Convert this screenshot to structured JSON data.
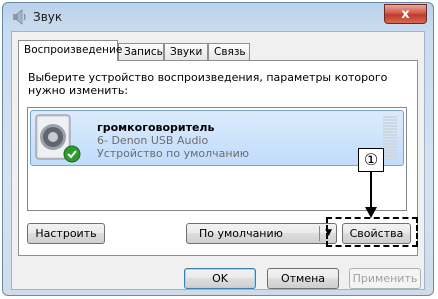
{
  "window": {
    "title": "Звук",
    "close_label": "x"
  },
  "tabs": [
    {
      "label": "Воспроизведение",
      "active": true
    },
    {
      "label": "Запись",
      "active": false
    },
    {
      "label": "Звуки",
      "active": false
    },
    {
      "label": "Связь",
      "active": false
    }
  ],
  "playback": {
    "instruction": "Выберите устройство воспроизведения, параметры которого нужно изменить:",
    "device": {
      "name": "громкоговоритель",
      "description": "6- Denon USB Audio",
      "status": "Устройство по умолчанию",
      "icon": "speaker-icon",
      "badge_icon": "check-icon"
    },
    "buttons": {
      "configure": "Настроить",
      "set_default": "По умолчанию",
      "properties": "Свойства"
    }
  },
  "dialog_buttons": {
    "ok": "OK",
    "cancel": "Отмена",
    "apply": "Применить"
  },
  "annotation": {
    "number": "①"
  },
  "colors": {
    "selection": "#c1dcfc",
    "check": "#2e9b2e",
    "close": "#c0392b"
  }
}
